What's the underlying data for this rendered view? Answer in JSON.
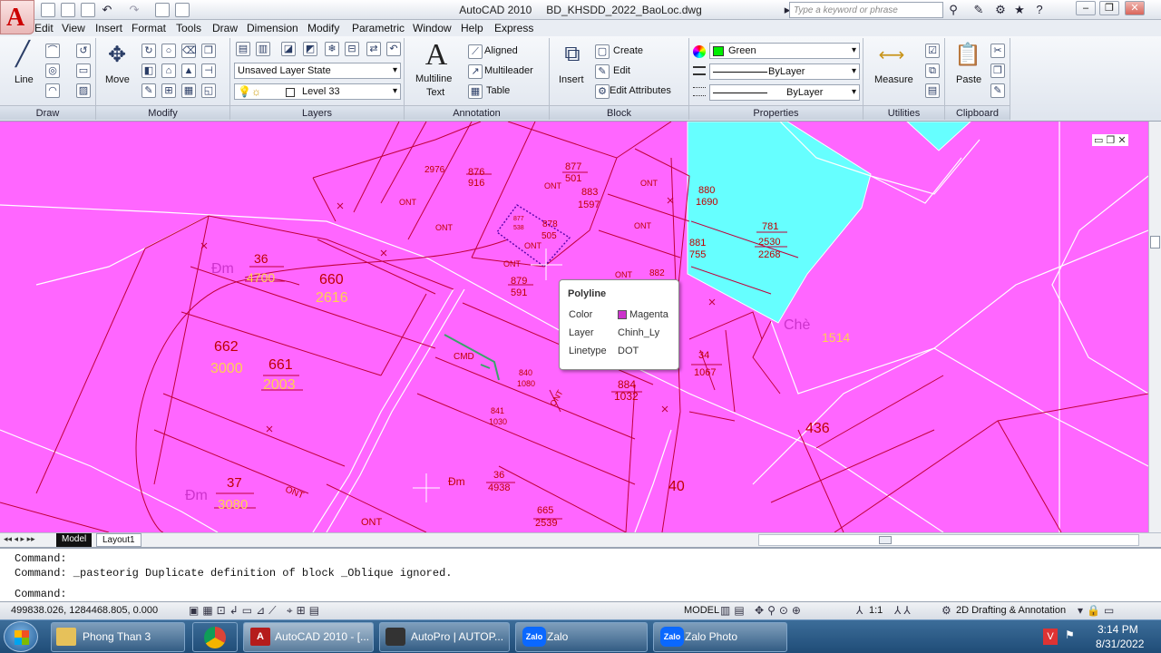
{
  "title_bar": {
    "app": "AutoCAD 2010",
    "file": "BD_KHSDD_2022_BaoLoc.dwg",
    "search_placeholder": "Type a keyword or phrase"
  },
  "menu": [
    "Edit",
    "View",
    "Insert",
    "Format",
    "Tools",
    "Draw",
    "Dimension",
    "Modify",
    "Parametric",
    "Window",
    "Help",
    "Express"
  ],
  "ribbon": {
    "draw": {
      "label": "Draw",
      "line": "Line"
    },
    "modify": {
      "label": "Modify",
      "move": "Move"
    },
    "layers": {
      "label": "Layers",
      "state": "Unsaved Layer State",
      "current": "Level 33"
    },
    "annotation": {
      "label": "Annotation",
      "mtext1": "Multiline",
      "mtext2": "Text",
      "aligned": "Aligned",
      "multileader": "Multileader",
      "table": "Table"
    },
    "block": {
      "label": "Block",
      "insert": "Insert",
      "create": "Create",
      "edit": "Edit",
      "edit_attr": "Edit Attributes"
    },
    "properties": {
      "label": "Properties",
      "color": "Green",
      "linetype": "ByLayer",
      "lineweight": "ByLayer"
    },
    "utilities": {
      "label": "Utilities",
      "measure": "Measure"
    },
    "clipboard": {
      "label": "Clipboard",
      "paste": "Paste"
    }
  },
  "colors": {
    "drawing_bg": "#ff66ff",
    "water_fill": "#66ffff",
    "line": "#c0003a",
    "label_red": "#c00000",
    "label_orange": "#ffd24d",
    "swatch_green": "#00ee00"
  },
  "drawing_labels": {
    "l2976": "2976",
    "l876": "876",
    "l916": "916",
    "l877": "877",
    "l501": "501",
    "l883": "883",
    "l1597": "1597",
    "ont1": "ONT",
    "ont2": "ONT",
    "ont3": "ONT",
    "ont4": "ONT",
    "ont5": "ONT",
    "ont6": "ONT",
    "ont7": "ONT",
    "ont8": "ONT",
    "ont9": "ONT",
    "ont10": "ONT",
    "ont11": "ONT",
    "l880": "880",
    "l1690": "1690",
    "l781": "781",
    "l2530": "2530",
    "l2268": "2268",
    "l881": "881",
    "l755": "755",
    "l878": "878",
    "l505": "505",
    "l877b": "877",
    "l538": "538",
    "l879": "879",
    "l591": "591",
    "l882": "882",
    "dm1": "Đm",
    "l36a": "36",
    "l4700": "4700",
    "l660": "660",
    "l2616": "2616",
    "l662": "662",
    "l3000": "3000",
    "l661": "661",
    "l2003": "2003",
    "cmd": "CMD",
    "l840": "840",
    "l1080": "1080",
    "l841": "841",
    "l1030": "1030",
    "l884": "884",
    "l1032": "1032",
    "l34": "34",
    "l1067": "1067",
    "che": "Chè",
    "l1514": "1514",
    "l436": "436",
    "dm2": "Đm",
    "l37": "37",
    "l3080": "3080",
    "dm3": "Đm",
    "l36b": "36",
    "l4938": "4938",
    "l665": "665",
    "l2539": "2539",
    "l40": "40"
  },
  "tooltip": {
    "title": "Polyline",
    "color_label": "Color",
    "color_value": "Magenta",
    "layer_label": "Layer",
    "layer_value": "Chinh_Ly",
    "linetype_label": "Linetype",
    "linetype_value": "DOT",
    "color_hex": "#cc33cc"
  },
  "layout_tabs": {
    "model": "Model",
    "layout1": "Layout1"
  },
  "command": {
    "line1": "Command:",
    "line2": "Command: _pasteorig Duplicate definition of block _Oblique  ignored.",
    "prompt": "Command:"
  },
  "status": {
    "coords": "499838.026, 1284468.805, 0.000",
    "model": "MODEL",
    "scale": "1:1",
    "workspace": "2D Drafting & Annotation"
  },
  "taskbar": {
    "item1": "Phong Than 3",
    "item2": "AutoCAD 2010 - [...",
    "item3": "AutoPro | AUTOP...",
    "item4": "Zalo",
    "item5": "Zalo Photo",
    "time": "3:14 PM",
    "date": "8/31/2022"
  }
}
